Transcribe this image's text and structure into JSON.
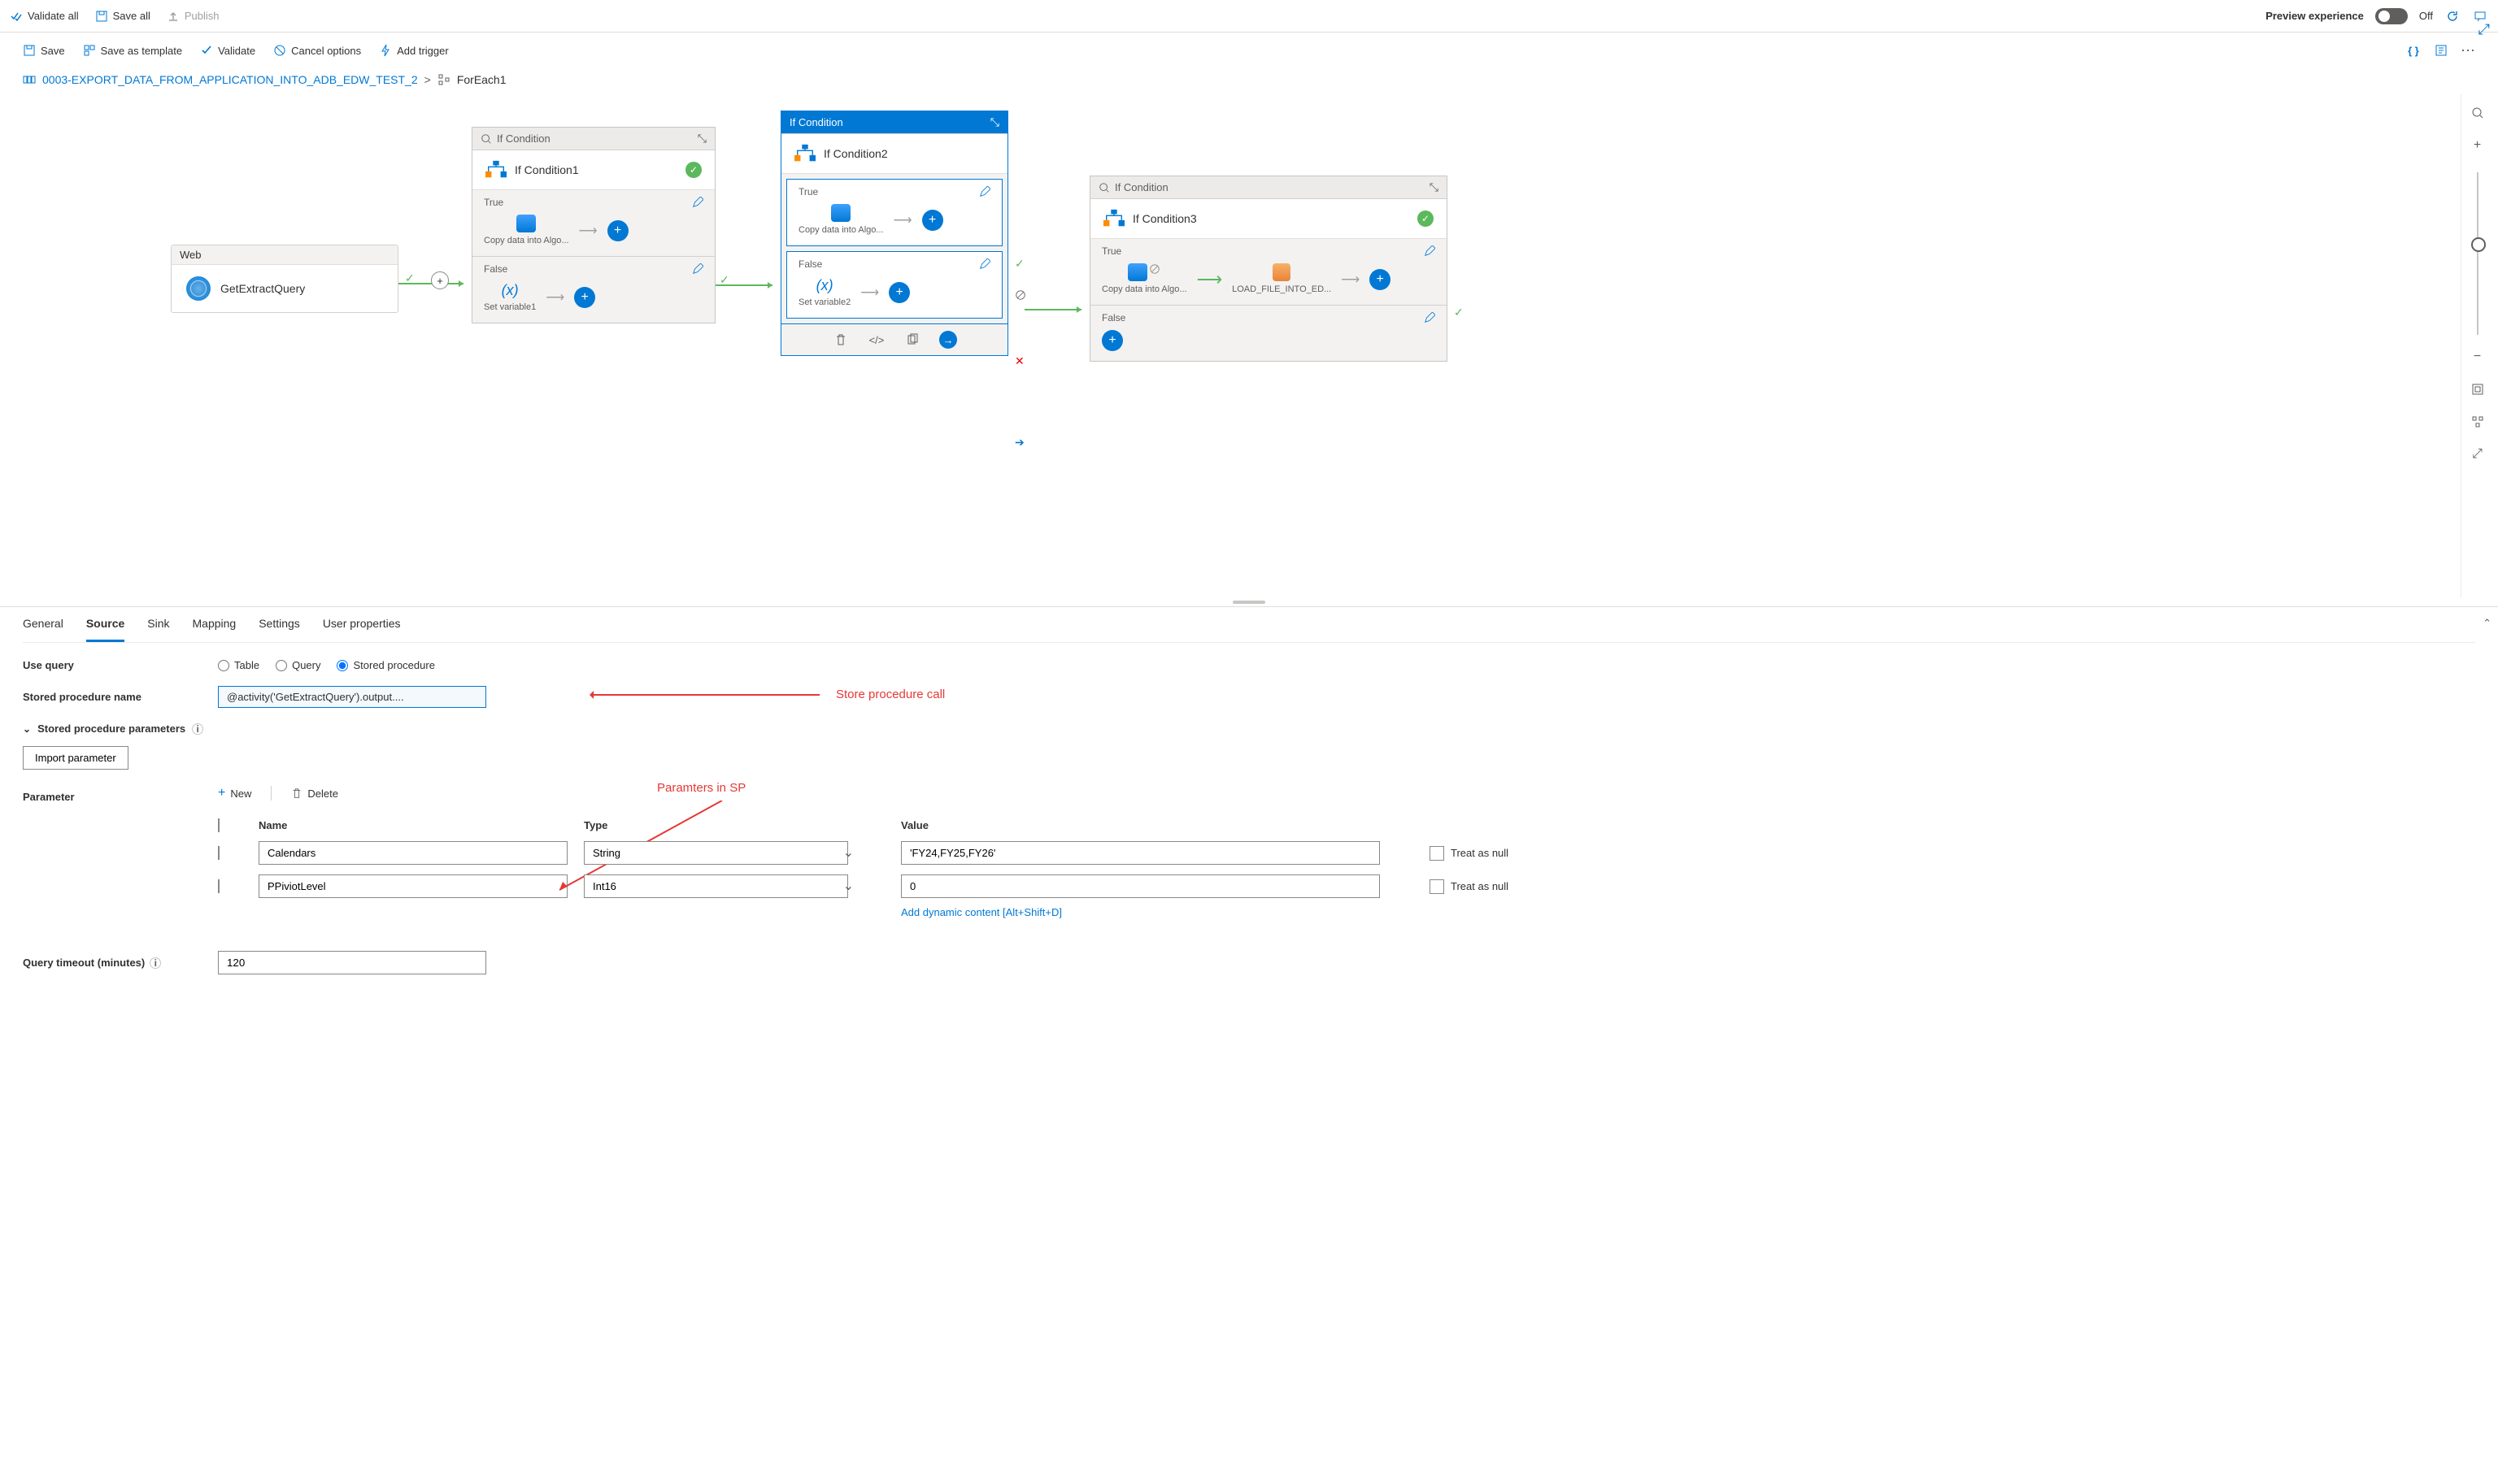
{
  "topToolbar": {
    "validateAll": "Validate all",
    "saveAll": "Save all",
    "publish": "Publish",
    "preview": "Preview experience",
    "toggle": "Off"
  },
  "secToolbar": {
    "save": "Save",
    "saveTemplate": "Save as template",
    "validate": "Validate",
    "cancel": "Cancel options",
    "addTrigger": "Add trigger"
  },
  "breadcrumb": {
    "root": "0003-EXPORT_DATA_FROM_APPLICATION_INTO_ADB_EDW_TEST_2",
    "current": "ForEach1"
  },
  "canvas": {
    "webHeader": "Web",
    "webName": "GetExtractQuery",
    "if1": {
      "type": "If Condition",
      "name": "If Condition1",
      "true": "True",
      "false": "False",
      "copy": "Copy data into Algo...",
      "setvar": "Set variable1"
    },
    "if2": {
      "type": "If Condition",
      "name": "If Condition2",
      "true": "True",
      "false": "False",
      "copy": "Copy data into Algo...",
      "setvar": "Set variable2"
    },
    "if3": {
      "type": "If Condition",
      "name": "If Condition3",
      "true": "True",
      "false": "False",
      "copy": "Copy data into Algo...",
      "load": "LOAD_FILE_INTO_ED..."
    }
  },
  "tabs": {
    "general": "General",
    "source": "Source",
    "sink": "Sink",
    "mapping": "Mapping",
    "settings": "Settings",
    "userProps": "User properties"
  },
  "form": {
    "useQuery": "Use query",
    "opts": {
      "table": "Table",
      "query": "Query",
      "sp": "Stored procedure"
    },
    "spName": "Stored procedure name",
    "spExpr": "@activity('GetExtractQuery').output....",
    "spParams": "Stored procedure parameters",
    "importParam": "Import parameter",
    "parameter": "Parameter",
    "new": "New",
    "delete": "Delete",
    "cols": {
      "name": "Name",
      "type": "Type",
      "value": "Value",
      "treat": "Treat as null"
    },
    "rows": [
      {
        "name": "Calendars",
        "type": "String",
        "value": "'FY24,FY25,FY26'"
      },
      {
        "name": "PPiviotLevel",
        "type": "Int16",
        "value": "0"
      }
    ],
    "dyn": "Add dynamic content [Alt+Shift+D]",
    "queryTimeout": "Query timeout (minutes)",
    "timeoutVal": "120"
  },
  "anno": {
    "spCall": "Store procedure call",
    "params": "Paramters in SP"
  }
}
